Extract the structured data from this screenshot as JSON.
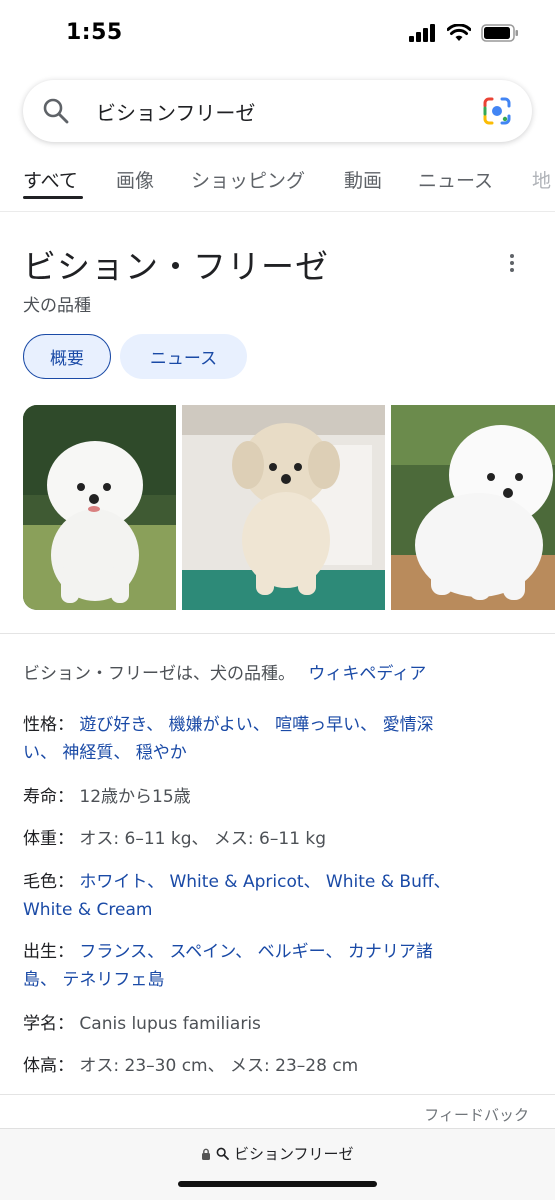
{
  "status_bar": {
    "time": "1:55",
    "signal_icon": "cellular-signal-icon",
    "wifi_icon": "wifi-icon",
    "battery_icon": "battery-icon"
  },
  "search": {
    "query": "ビションフリーゼ",
    "search_icon": "search-icon",
    "lens_icon": "google-lens-icon"
  },
  "tabs": [
    {
      "label": "すべて",
      "active": true
    },
    {
      "label": "画像"
    },
    {
      "label": "ショッピング"
    },
    {
      "label": "動画"
    },
    {
      "label": "ニュース"
    },
    {
      "label": "地"
    }
  ],
  "knowledge_panel": {
    "title": "ビション・フリーゼ",
    "subtitle": "犬の品種",
    "chips": {
      "overview": "概要",
      "news": "ニュース"
    },
    "description": "ビション・フリーゼは、犬の品種。",
    "source_link": "ウィキペディア",
    "facts": {
      "temperament": {
        "label": "性格：",
        "line1": "遊び好き、 機嫌がよい、 喧嘩っ早い、 愛情深",
        "line2": "い、 神経質、 穏やか"
      },
      "lifespan": {
        "label": "寿命：",
        "value": "12歳から15歳"
      },
      "weight": {
        "label": "体重：",
        "value": "オス: 6–11 kg、 メス: 6–11 kg"
      },
      "coat_colors": {
        "label": "毛色：",
        "line1": "ホワイト、 White & Apricot、 White & Buff、",
        "line2": "White & Cream"
      },
      "origin": {
        "label": "出生：",
        "line1": "フランス、 スペイン、 ベルギー、 カナリア諸",
        "line2": "島、 テネリフェ島"
      },
      "scientific_name": {
        "label": "学名：",
        "value": "Canis lupus familiaris"
      },
      "height": {
        "label": "体高：",
        "value": "オス: 23–30 cm、 メス: 23–28 cm"
      }
    },
    "feedback": "フィードバック"
  },
  "browser": {
    "url_text": "ビションフリーゼ",
    "lock_icon": "lock-icon"
  },
  "colors": {
    "link": "#1a4aa6",
    "chip_bg": "#e8f0fe",
    "text": "#202124",
    "secondary": "#4d5156"
  }
}
